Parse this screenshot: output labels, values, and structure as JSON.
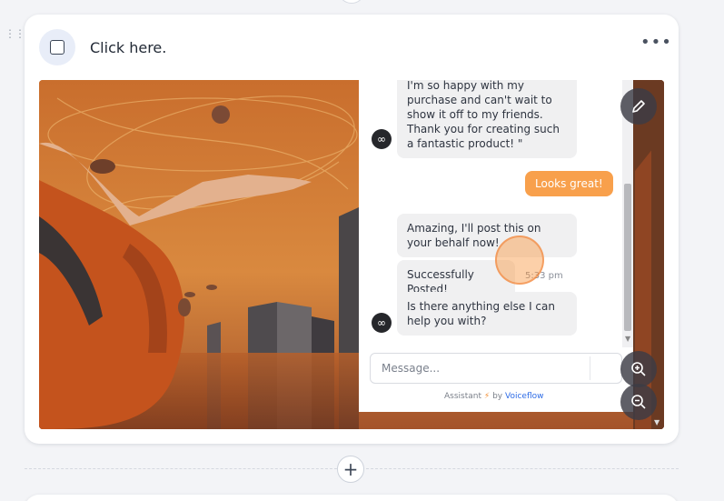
{
  "step": {
    "title": "Click here.",
    "more_label": "•••"
  },
  "chat": {
    "messages": [
      {
        "role": "assistant",
        "text": "I'm so happy with my purchase and can't wait to show it off to my friends. Thank you for creating such a fantastic product! \""
      },
      {
        "role": "user",
        "text": "Looks great!"
      },
      {
        "role": "assistant",
        "text": "Amazing, I'll post this on your behalf now!"
      },
      {
        "role": "assistant",
        "text": "Successfully Posted!"
      },
      {
        "role": "assistant",
        "text": "Is there anything else I can help you with?"
      }
    ],
    "timestamp": "5:33 pm",
    "input_placeholder": "Message...",
    "powered_prefix": "Assistant",
    "powered_by": "by",
    "powered_brand": "Voiceflow"
  },
  "add_label": "+",
  "colors": {
    "accent": "#f8a04c",
    "brand_link": "#2e6ce6"
  }
}
